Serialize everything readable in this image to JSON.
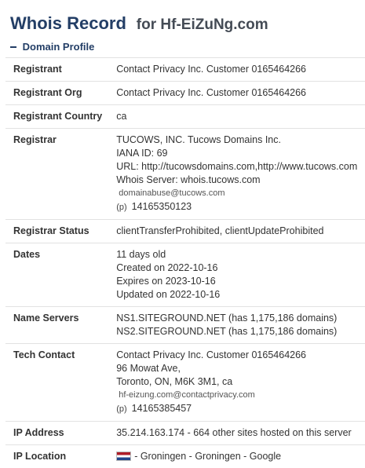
{
  "header": {
    "title": "Whois Record",
    "for_text": "for Hf-EiZuNg.com"
  },
  "section": {
    "label": "Domain Profile"
  },
  "rows": {
    "registrant": {
      "label": "Registrant",
      "value": "Contact Privacy Inc. Customer 0165464266"
    },
    "registrant_org": {
      "label": "Registrant Org",
      "value": "Contact Privacy Inc. Customer 0165464266"
    },
    "registrant_country": {
      "label": "Registrant Country",
      "value": "ca"
    },
    "registrar": {
      "label": "Registrar",
      "name": "TUCOWS, INC. Tucows Domains Inc.",
      "iana": "IANA ID: 69",
      "url": "URL: http://tucowsdomains.com,http://www.tucows.com",
      "whois_server": "Whois Server: whois.tucows.com",
      "email": "domainabuse@tucows.com",
      "phone_tag": "(p)",
      "phone": "14165350123"
    },
    "registrar_status": {
      "label": "Registrar Status",
      "value": "clientTransferProhibited, clientUpdateProhibited"
    },
    "dates": {
      "label": "Dates",
      "age": "11 days old",
      "created": "Created on 2022-10-16",
      "expires": "Expires on 2023-10-16",
      "updated": "Updated on 2022-10-16"
    },
    "name_servers": {
      "label": "Name Servers",
      "ns1": "NS1.SITEGROUND.NET (has 1,175,186 domains)",
      "ns2": "NS2.SITEGROUND.NET (has 1,175,186 domains)"
    },
    "tech_contact": {
      "label": "Tech Contact",
      "name": "Contact Privacy Inc. Customer 0165464266",
      "street": "96 Mowat Ave,",
      "city": "Toronto, ON, M6K 3M1, ca",
      "email": "hf-eizung.com@contactprivacy.com",
      "phone_tag": "(p)",
      "phone": "14165385457"
    },
    "ip_address": {
      "label": "IP Address",
      "value": "35.214.163.174 - 664 other sites hosted on this server"
    },
    "ip_location": {
      "label": "IP Location",
      "value": "- Groningen - Groningen - Google",
      "flag": "netherlands-flag"
    }
  },
  "colors": {
    "title": "#233e66",
    "border": "#e2e2e2",
    "text": "#333333"
  }
}
